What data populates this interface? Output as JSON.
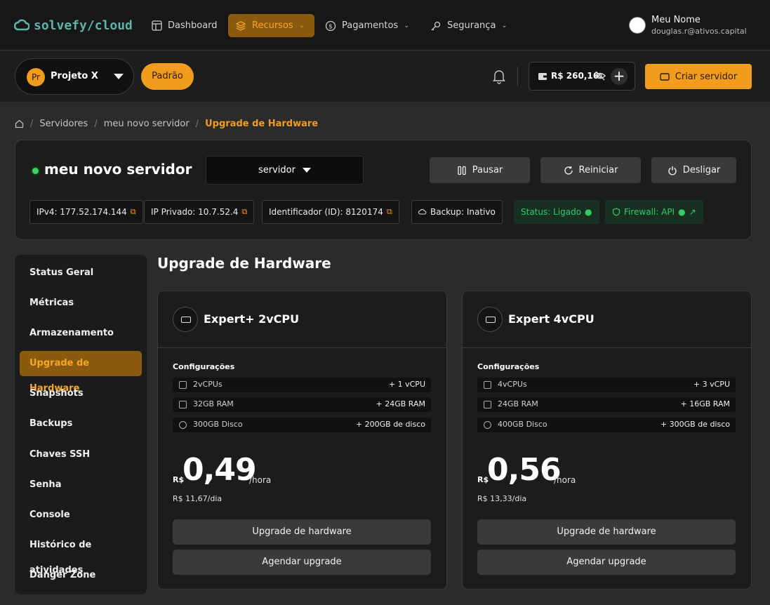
{
  "nav": {
    "logo": "solvefy/cloud",
    "items": [
      {
        "label": "Dashboard",
        "icon": "layout-icon"
      },
      {
        "label": "Recursos",
        "icon": "layers-icon"
      },
      {
        "label": "Pagamentos",
        "icon": "dollar-icon"
      },
      {
        "label": "Segurança",
        "icon": "key-icon"
      }
    ],
    "user": {
      "name": "Meu Nome",
      "email": "douglas.r@ativos.capital"
    }
  },
  "toolbar": {
    "project_initials": "Pr",
    "project_name": "Projeto X",
    "tag": "Padrão",
    "balance": "R$ 260,16",
    "add_label": "+",
    "create_label": "Criar servidor"
  },
  "breadcrumb": {
    "items": [
      "Servidores",
      "meu novo servidor"
    ],
    "current": "Upgrade de Hardware"
  },
  "server": {
    "name": "meu novo servidor",
    "type_select": "servidor",
    "actions": {
      "pause": "Pausar",
      "restart": "Reiniciar",
      "shutdown": "Desligar"
    },
    "chips": {
      "ipv4": "IPv4: 177.52.174.144",
      "private_ip": "IP Privado: 10.7.52.4",
      "id": "Identificador (ID): 8120174",
      "backup": "Backup: Inativo",
      "status": "Status: Ligado",
      "firewall": "Firewall: API"
    },
    "colors": {
      "status_on": "#37c86a",
      "accent": "#f29c1e"
    }
  },
  "sidebar": {
    "items": [
      "Status Geral",
      "Métricas",
      "Armazenamento",
      "Upgrade de Hardware",
      "Snapshots",
      "Backups",
      "Chaves SSH",
      "Senha",
      "Console",
      "Histórico de atividades",
      "Danger Zone"
    ],
    "active": "Upgrade de Hardware"
  },
  "main": {
    "title": "Upgrade de Hardware",
    "config_title": "Configurações",
    "plans": [
      {
        "name": "Expert+ 2vCPU",
        "specs": [
          {
            "name": "2vCPUs",
            "delta": "+ 1 vCPU",
            "icon": "cpu-icon"
          },
          {
            "name": "32GB RAM",
            "delta": "+ 24GB RAM",
            "icon": "memory-icon"
          },
          {
            "name": "300GB Disco",
            "delta": "+ 200GB de disco",
            "icon": "disk-icon"
          }
        ],
        "currency": "R$",
        "price": "0,49",
        "unit": "/hora",
        "per_day": "R$ 11,67/dia",
        "upgrade_label": "Upgrade de hardware",
        "schedule_label": "Agendar upgrade"
      },
      {
        "name": "Expert 4vCPU",
        "specs": [
          {
            "name": "4vCPUs",
            "delta": "+ 3 vCPU",
            "icon": "cpu-icon"
          },
          {
            "name": "24GB RAM",
            "delta": "+ 16GB RAM",
            "icon": "memory-icon"
          },
          {
            "name": "400GB Disco",
            "delta": "+ 300GB de disco",
            "icon": "disk-icon"
          }
        ],
        "currency": "R$",
        "price": "0,56",
        "unit": "/hora",
        "per_day": "R$ 13,33/dia",
        "upgrade_label": "Upgrade de hardware",
        "schedule_label": "Agendar upgrade"
      }
    ]
  }
}
